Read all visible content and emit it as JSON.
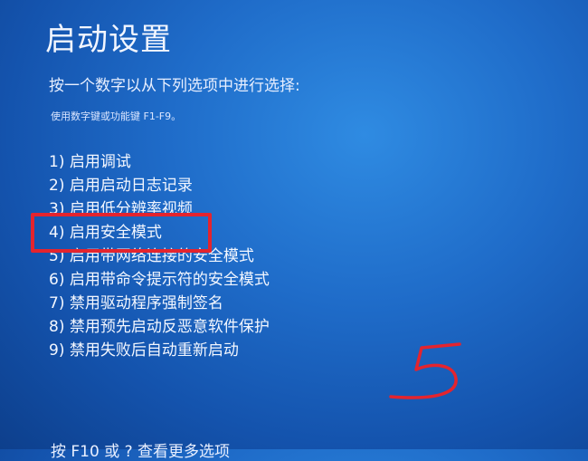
{
  "screen": {
    "title": "启动设置",
    "prompt": "按一个数字以从下列选项中进行选择:",
    "hint": "使用数字键或功能键 F1-F9。",
    "options": [
      "1) 启用调试",
      "2) 启用启动日志记录",
      "3) 启用低分辨率视频",
      "4) 启用安全模式",
      "5) 启用带网络连接的安全模式",
      "6) 启用带命令提示符的安全模式",
      "7) 禁用驱动程序强制签名",
      "8) 禁用预先启动反恶意软件保护",
      "9) 禁用失败后自动重新启动"
    ],
    "footer": "按 F10 或 ? 查看更多选项"
  },
  "annotations": {
    "highlight_color": "#e4242e",
    "handwritten_number": "5"
  }
}
